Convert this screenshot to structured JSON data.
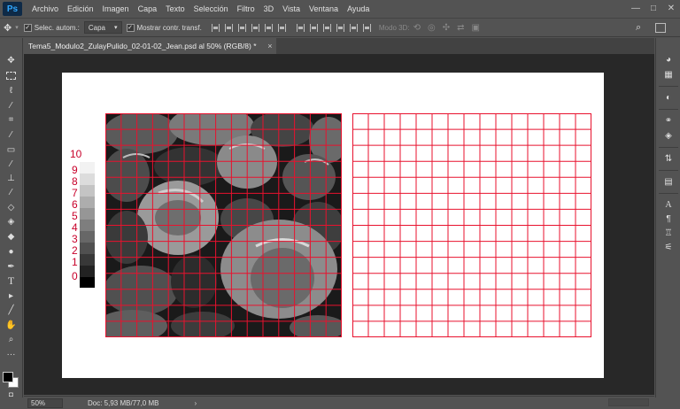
{
  "app": {
    "logo": "Ps"
  },
  "menu": [
    "Archivo",
    "Edición",
    "Imagen",
    "Capa",
    "Texto",
    "Selección",
    "Filtro",
    "3D",
    "Vista",
    "Ventana",
    "Ayuda"
  ],
  "window_controls": {
    "minimize": "—",
    "maximize": "□",
    "close": "✕"
  },
  "options_bar": {
    "auto_select_label": "Selec. autom.:",
    "auto_select_checked": true,
    "auto_select_target": "Capa",
    "show_transform_label": "Mostrar contr. transf.",
    "show_transform_checked": true,
    "mode_3d_label": "Modo 3D:"
  },
  "document_tab": {
    "title": "Tema5_Modulo2_ZulayPulido_02-01-02_Jean.psd al 50% (RGB/8) *",
    "close": "×"
  },
  "gray_scale": {
    "labels": [
      "10",
      "9",
      "8",
      "7",
      "6",
      "5",
      "4",
      "3",
      "2",
      "1",
      "0"
    ],
    "swatch_colors": [
      "#f2f2f2",
      "#dcdcdc",
      "#c4c4c4",
      "#adadad",
      "#969696",
      "#7e7e7e",
      "#676767",
      "#505050",
      "#383838",
      "#222222",
      "#000000"
    ]
  },
  "grid": {
    "columns": 15,
    "rows": 14,
    "line_color": "#e8122e"
  },
  "status_bar": {
    "zoom": "50%",
    "doc_info": "Doc: 5,93 MB/77,0 MB",
    "arrow": "›"
  },
  "tools": [
    "move",
    "marquee",
    "lasso",
    "magic-wand",
    "crop",
    "eyedropper",
    "healing",
    "brush",
    "clone-stamp",
    "history-brush",
    "eraser",
    "gradient",
    "blur",
    "dodge",
    "pen",
    "type",
    "path-selection",
    "line",
    "hand",
    "zoom",
    "more"
  ],
  "right_panel_icons": [
    "color",
    "swatches",
    "adjustments",
    "styles",
    "layers",
    "channels",
    "paths",
    "character",
    "paragraph",
    "glyphs",
    "properties",
    "libraries"
  ]
}
